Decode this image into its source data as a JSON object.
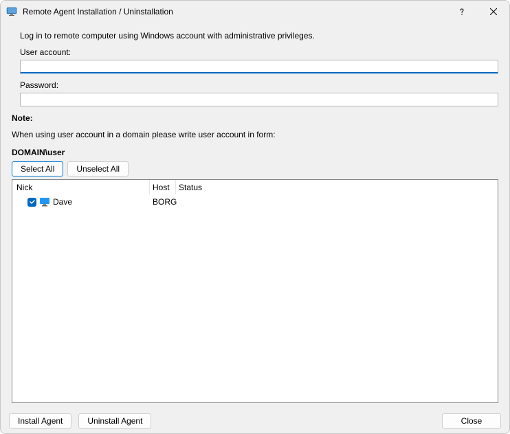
{
  "titlebar": {
    "title": "Remote Agent Installation / Uninstallation"
  },
  "instruction": "Log in to remote computer using Windows account with administrative privileges.",
  "labels": {
    "user_account": "User account:",
    "password": "Password:",
    "note": "Note:"
  },
  "fields": {
    "user_account_value": "",
    "password_value": ""
  },
  "note_text": "When using user account in a domain please write user account in form:",
  "domain_format": "DOMAIN\\user",
  "buttons": {
    "select_all": "Select All",
    "unselect_all": "Unselect All",
    "install_agent": "Install Agent",
    "uninstall_agent": "Uninstall Agent",
    "close": "Close"
  },
  "columns": {
    "nick": "Nick",
    "host": "Host",
    "status": "Status"
  },
  "rows": [
    {
      "checked": true,
      "nick": "Dave",
      "host": "BORG",
      "status": ""
    }
  ]
}
